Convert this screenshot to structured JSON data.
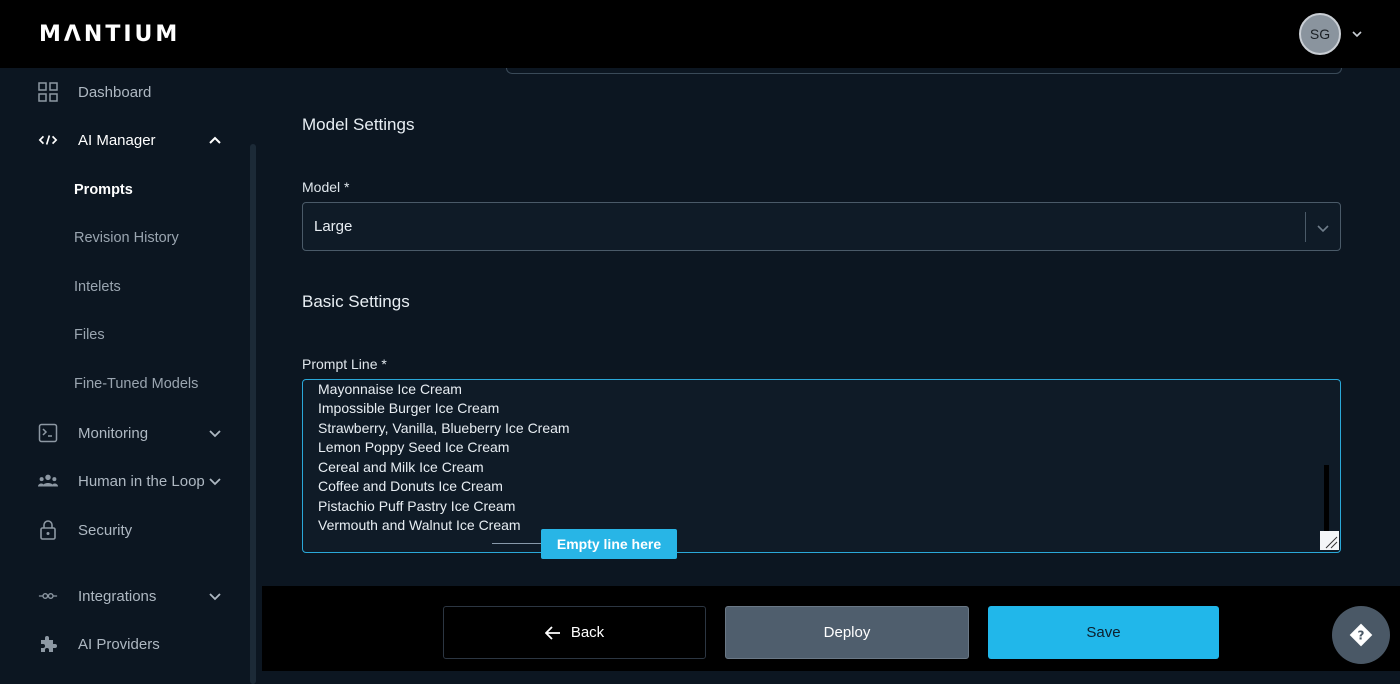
{
  "brand": {
    "logo_text": "MΛNTIUM"
  },
  "user": {
    "initials": "SG"
  },
  "sidebar": {
    "dashboard": "Dashboard",
    "ai_manager": "AI Manager",
    "sub_items": [
      "Prompts",
      "Revision History",
      "Intelets",
      "Files",
      "Fine-Tuned Models"
    ],
    "monitoring": "Monitoring",
    "human_in_the_loop": "Human in the Loop",
    "security": "Security",
    "integrations": "Integrations",
    "ai_providers": "AI Providers"
  },
  "main": {
    "model_settings_title": "Model Settings",
    "model_label": "Model *",
    "model_value": "Large",
    "basic_settings_title": "Basic Settings",
    "prompt_line_label": "Prompt Line *",
    "prompt_lines": [
      "Mayonnaise Ice Cream",
      "Impossible Burger Ice Cream",
      "Strawberry, Vanilla, Blueberry Ice Cream",
      "Lemon Poppy Seed Ice Cream",
      "Cereal and Milk Ice Cream",
      "Coffee and Donuts Ice Cream",
      "Pistachio Puff Pastry Ice Cream",
      "Vermouth and Walnut Ice Cream"
    ],
    "callout": "Empty line here"
  },
  "footer": {
    "back_label": "Back",
    "deploy_label": "Deploy",
    "save_label": "Save"
  },
  "colors": {
    "accent": "#21b7ea",
    "background": "#0c1621",
    "topbar": "#000000"
  }
}
